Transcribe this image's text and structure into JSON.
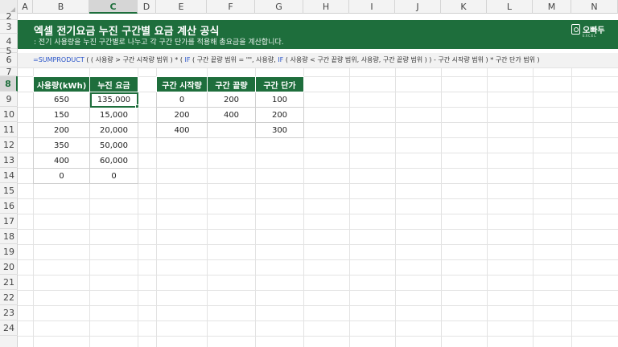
{
  "columns": [
    "A",
    "B",
    "C",
    "D",
    "E",
    "F",
    "G",
    "H",
    "I",
    "J",
    "K",
    "L",
    "M",
    "N"
  ],
  "rows": [
    "2",
    "3",
    "4",
    "5",
    "6",
    "7",
    "8",
    "9",
    "10",
    "11",
    "12",
    "13",
    "14",
    "15",
    "16",
    "17",
    "18",
    "19",
    "20",
    "21",
    "22",
    "23",
    "24"
  ],
  "selected_cell": {
    "column": "C",
    "row": "8"
  },
  "banner": {
    "title": "엑셀 전기요금 누진 구간별 요금 계산 공식",
    "subtitle": ": 전기 사용량을 누진 구간별로 나누고 각 구간 단가를 적용해 총요금을 계산합니다.",
    "logo_text": "오빠두",
    "logo_sub": "EXCEL",
    "color": "#1e6e3c"
  },
  "formula": {
    "segments": [
      {
        "text": "=SUMPRODUCT",
        "fn": true
      },
      {
        "text": " ( ( 사용량 > 구간 시작량 범위 ) * ( ",
        "fn": false
      },
      {
        "text": "IF",
        "fn": true
      },
      {
        "text": " ( 구간 끝량 범위 = \"\", 사용량, ",
        "fn": false
      },
      {
        "text": "IF",
        "fn": true
      },
      {
        "text": " ( 사용량 < 구간 끝량 범위, 사용량, 구간 끝량 범위 ) ) - 구간 시작량 범위 ) * 구간 단가 범위 )",
        "fn": false
      }
    ]
  },
  "usage_table": {
    "headers": [
      "사용량(kWh)",
      "누진 요금"
    ],
    "rows": [
      [
        "650",
        "135,000"
      ],
      [
        "150",
        "15,000"
      ],
      [
        "200",
        "20,000"
      ],
      [
        "350",
        "50,000"
      ],
      [
        "400",
        "60,000"
      ],
      [
        "0",
        "0"
      ]
    ]
  },
  "tier_table": {
    "headers": [
      "구간 시작량",
      "구간 끝량",
      "구간 단가"
    ],
    "rows": [
      [
        "0",
        "200",
        "100"
      ],
      [
        "200",
        "400",
        "200"
      ],
      [
        "400",
        "",
        "300"
      ]
    ]
  },
  "colors": {
    "header_green": "#1e6e3c",
    "function_blue": "#2a55c9"
  }
}
